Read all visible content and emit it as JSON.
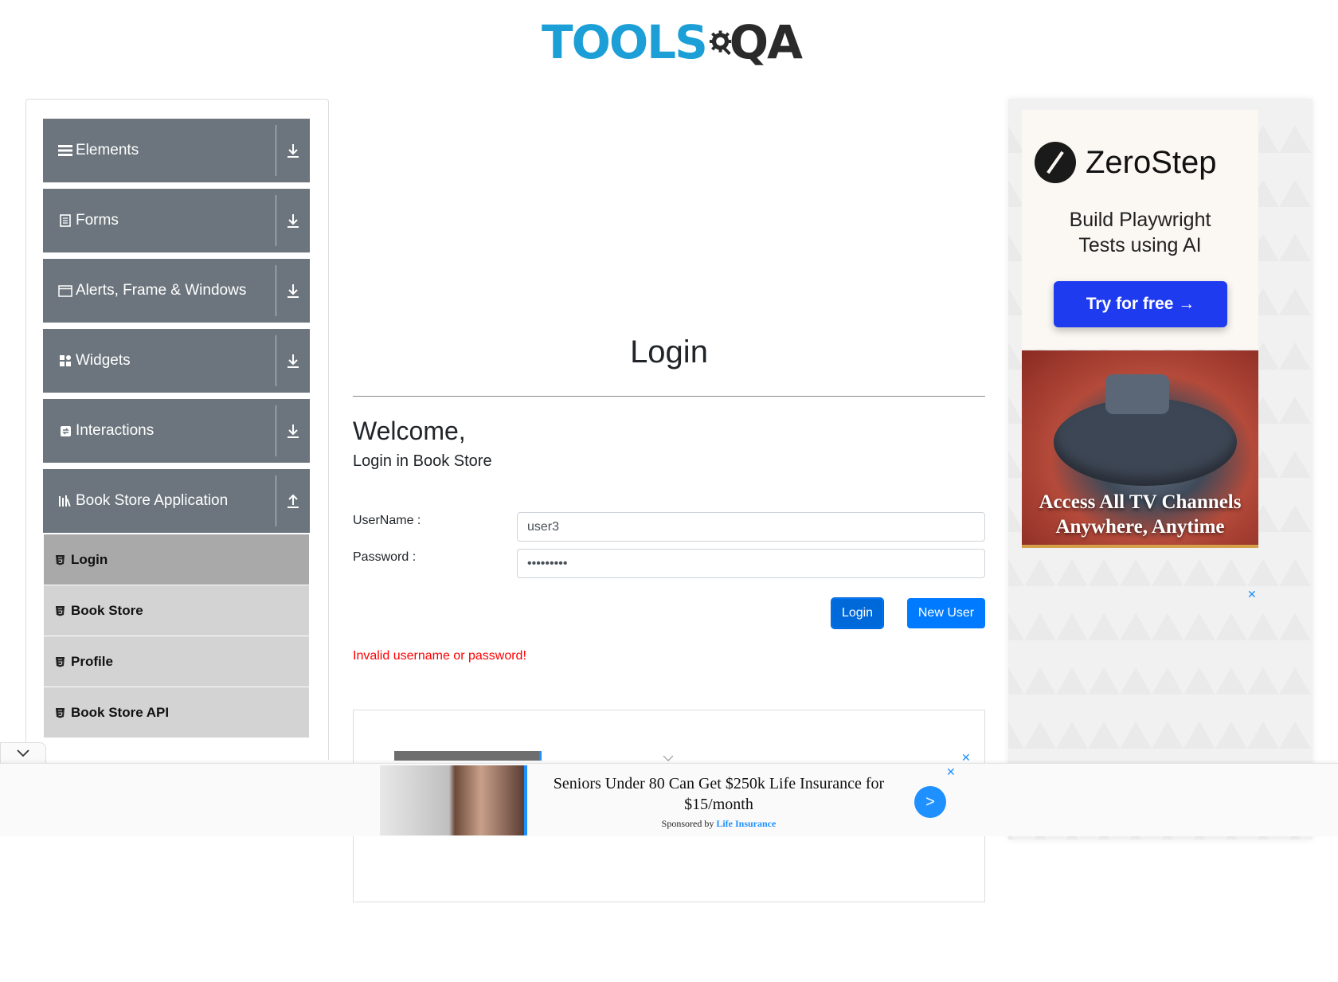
{
  "header": {
    "logo_part1": "TOOLS",
    "logo_part2": "QA"
  },
  "sidebar": {
    "groups": [
      {
        "label": "Elements",
        "icon": "hamburger-icon",
        "toggle": "download-icon"
      },
      {
        "label": "Forms",
        "icon": "document-icon",
        "toggle": "download-icon"
      },
      {
        "label": "Alerts, Frame & Windows",
        "icon": "window-icon",
        "toggle": "download-icon"
      },
      {
        "label": "Widgets",
        "icon": "widgets-icon",
        "toggle": "download-icon"
      },
      {
        "label": "Interactions",
        "icon": "interactions-icon",
        "toggle": "download-icon"
      },
      {
        "label": "Book Store Application",
        "icon": "books-icon",
        "toggle": "upload-icon"
      }
    ],
    "bookstore_items": [
      {
        "label": "Login",
        "active": true
      },
      {
        "label": "Book Store",
        "active": false
      },
      {
        "label": "Profile",
        "active": false
      },
      {
        "label": "Book Store API",
        "active": false
      }
    ]
  },
  "main": {
    "title": "Login",
    "welcome": "Welcome,",
    "subtitle": "Login in Book Store",
    "username_label": "UserName :",
    "username_value": "user3",
    "password_label": "Password :",
    "password_value": "•••••••••",
    "login_button": "Login",
    "new_user_button": "New User",
    "error": "Invalid username or password!"
  },
  "right_ads": {
    "zerostep_brand": "ZeroStep",
    "zerostep_tag_line1": "Build Playwright",
    "zerostep_tag_line2": "Tests using AI",
    "zerostep_cta": "Try for free →",
    "tv_line1": "Access All TV Channels",
    "tv_line2": "Anywhere, Anytime",
    "close": "✕"
  },
  "bottom_ad": {
    "headline": "Seniors Under 80 Can Get $250k Life Insurance for $15/month",
    "sponsored_prefix": "Sponsored by",
    "sponsor": "Life Insurance",
    "go": ">",
    "close": "✕"
  },
  "colors": {
    "accent": "#007bff",
    "sidebar_group": "#6c757d",
    "sub_item": "#d3d3d3",
    "sub_active": "#a9a9a9",
    "error": "#ff0000"
  }
}
